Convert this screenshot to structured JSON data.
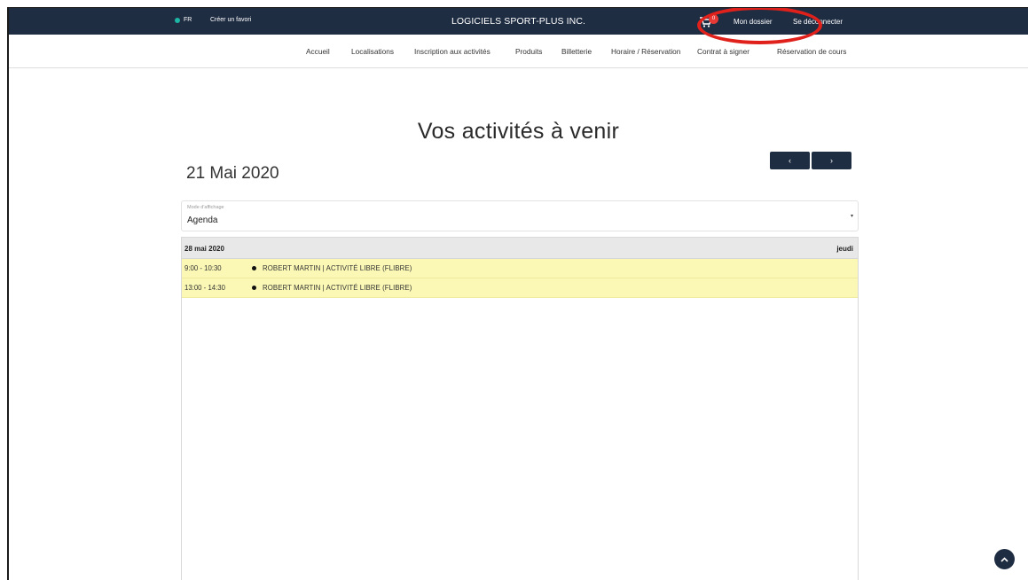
{
  "topbar": {
    "lang": "FR",
    "favorite_link": "Créer un favori",
    "brand": "LOGICIELS SPORT-PLUS INC.",
    "cart_count": "0",
    "my_account": "Mon dossier",
    "logout": "Se déconnecter",
    "colors": {
      "bar": "#1f2d43",
      "lang_dot": "#1db5a3",
      "badge": "#e53935",
      "highlight": "#e0211b"
    }
  },
  "nav": {
    "items": [
      {
        "label": "Accueil"
      },
      {
        "label": "Localisations"
      },
      {
        "label": "Inscription aux activités"
      },
      {
        "label": "Produits"
      },
      {
        "label": "Billetterie"
      },
      {
        "label": "Horaire / Réservation"
      },
      {
        "label": "Contrat à signer"
      },
      {
        "label": "Réservation de cours"
      }
    ]
  },
  "main": {
    "title": "Vos activités à venir",
    "current_date": "21 Mai 2020",
    "prev_icon": "‹",
    "next_icon": "›",
    "mode": {
      "label": "Mode d'affichage",
      "value": "Agenda",
      "caret": "▾"
    }
  },
  "agenda": {
    "day": {
      "date": "28 mai 2020",
      "weekday": "jeudi"
    },
    "events": [
      {
        "time": "9:00 - 10:30",
        "title": "ROBERT MARTIN | ACTIVITÉ LIBRE (FLIBRE)"
      },
      {
        "time": "13:00 - 14:30",
        "title": "ROBERT MARTIN | ACTIVITÉ LIBRE (FLIBRE)"
      }
    ],
    "colors": {
      "event_bg": "#fbf8b5",
      "day_header_bg": "#e8e8e8"
    }
  },
  "icons": {
    "cart": "cart-icon",
    "scroll_top": "chevron-up-icon"
  }
}
